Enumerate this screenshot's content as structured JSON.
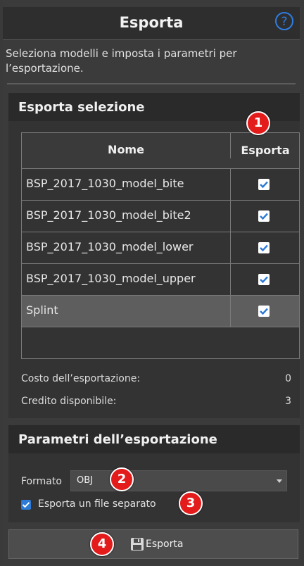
{
  "header": {
    "title": "Esporta",
    "help_icon": "help-circle-icon"
  },
  "description": "Seleziona modelli e imposta i parametri per l’esportazione.",
  "export_selection": {
    "title": "Esporta selezione",
    "columns": {
      "name": "Nome",
      "export": "Esporta"
    },
    "rows": [
      {
        "name": "BSP_2017_1030_model_bite",
        "checked": true,
        "selected": false
      },
      {
        "name": "BSP_2017_1030_model_bite2",
        "checked": true,
        "selected": false
      },
      {
        "name": "BSP_2017_1030_model_lower",
        "checked": true,
        "selected": false
      },
      {
        "name": "BSP_2017_1030_model_upper",
        "checked": true,
        "selected": false
      },
      {
        "name": "Splint",
        "checked": true,
        "selected": true
      }
    ],
    "cost_label": "Costo dell’esportazione:",
    "cost_value": "0",
    "credit_label": "Credito disponibile:",
    "credit_value": "3"
  },
  "params": {
    "title": "Parametri dell’esportazione",
    "format_label": "Formato",
    "format_value": "OBJ",
    "separate_file_label": "Esporta un file separato",
    "separate_file_checked": true
  },
  "export_button": {
    "label": "Esporta",
    "icon": "save-icon"
  },
  "markers": [
    "1",
    "2",
    "3",
    "4"
  ],
  "colors": {
    "accent": "#2d7bd6",
    "marker": "#e31b1b",
    "help": "#2f7de1"
  }
}
